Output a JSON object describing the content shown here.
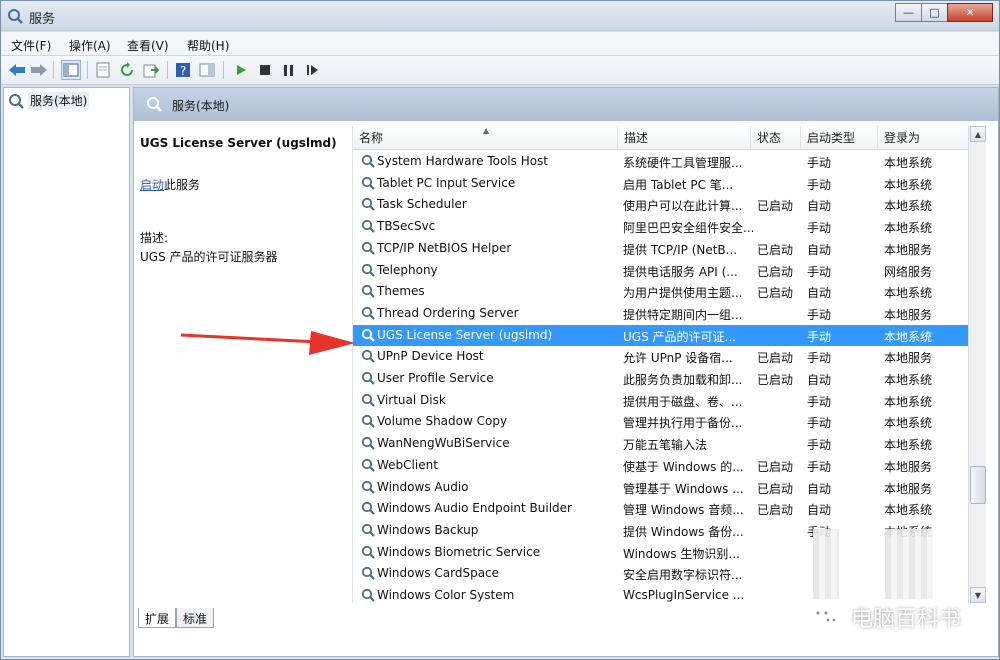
{
  "window": {
    "title": "服务"
  },
  "menu": [
    "文件(F)",
    "操作(A)",
    "查看(V)",
    "帮助(H)"
  ],
  "toolbar": {
    "icons": [
      "back-arrow-icon",
      "forward-arrow-icon",
      "console-tree-icon",
      "properties-icon",
      "refresh-icon",
      "export-icon",
      "help-icon",
      "show-hide-pane-icon",
      "start-icon",
      "stop-icon",
      "pause-icon",
      "restart-icon"
    ]
  },
  "tree": {
    "root_label": "服务(本地)"
  },
  "header": {
    "title": "服务(本地)"
  },
  "details": {
    "service_title": "UGS License Server (ugslmd)",
    "start_link": "启动",
    "start_suffix": "此服务",
    "desc_label": "描述:",
    "desc_text": "UGS 产品的许可证服务器"
  },
  "columns": {
    "name": "名称",
    "description": "描述",
    "status": "状态",
    "startup": "启动类型",
    "logon": "登录为"
  },
  "services": [
    {
      "name": "System Hardware Tools Host",
      "description": "系统硬件工具管理服...",
      "status": "",
      "startup": "手动",
      "logon": "本地系统"
    },
    {
      "name": "Tablet PC Input Service",
      "description": "启用 Tablet PC 笔...",
      "status": "",
      "startup": "手动",
      "logon": "本地系统"
    },
    {
      "name": "Task Scheduler",
      "description": "使用户可以在此计算...",
      "status": "已启动",
      "startup": "自动",
      "logon": "本地系统"
    },
    {
      "name": "TBSecSvc",
      "description": "阿里巴巴安全组件安全...",
      "status": "",
      "startup": "手动",
      "logon": "本地系统"
    },
    {
      "name": "TCP/IP NetBIOS Helper",
      "description": "提供 TCP/IP (NetB...",
      "status": "已启动",
      "startup": "自动",
      "logon": "本地服务"
    },
    {
      "name": "Telephony",
      "description": "提供电话服务 API (...",
      "status": "已启动",
      "startup": "手动",
      "logon": "网络服务"
    },
    {
      "name": "Themes",
      "description": "为用户提供使用主题...",
      "status": "已启动",
      "startup": "自动",
      "logon": "本地系统"
    },
    {
      "name": "Thread Ordering Server",
      "description": "提供特定期间内一组...",
      "status": "",
      "startup": "手动",
      "logon": "本地服务"
    },
    {
      "name": "UGS License Server (ugslmd)",
      "description": "UGS 产品的许可证...",
      "status": "",
      "startup": "手动",
      "logon": "本地系统"
    },
    {
      "name": "UPnP Device Host",
      "description": "允许 UPnP 设备宿...",
      "status": "已启动",
      "startup": "手动",
      "logon": "本地服务"
    },
    {
      "name": "User Profile Service",
      "description": "此服务负责加载和卸...",
      "status": "已启动",
      "startup": "自动",
      "logon": "本地系统"
    },
    {
      "name": "Virtual Disk",
      "description": "提供用于磁盘、卷、...",
      "status": "",
      "startup": "手动",
      "logon": "本地系统"
    },
    {
      "name": "Volume Shadow Copy",
      "description": "管理并执行用于备份...",
      "status": "",
      "startup": "手动",
      "logon": "本地系统"
    },
    {
      "name": "WanNengWuBiService",
      "description": "万能五笔输入法",
      "status": "",
      "startup": "手动",
      "logon": "本地系统"
    },
    {
      "name": "WebClient",
      "description": "使基于 Windows 的...",
      "status": "已启动",
      "startup": "手动",
      "logon": "本地服务"
    },
    {
      "name": "Windows Audio",
      "description": "管理基于 Windows ...",
      "status": "已启动",
      "startup": "自动",
      "logon": "本地服务"
    },
    {
      "name": "Windows Audio Endpoint Builder",
      "description": "管理 Windows 音频...",
      "status": "已启动",
      "startup": "自动",
      "logon": "本地系统"
    },
    {
      "name": "Windows Backup",
      "description": "提供 Windows 备份...",
      "status": "",
      "startup": "手动",
      "logon": "本地系统"
    },
    {
      "name": "Windows Biometric Service",
      "description": "Windows 生物识别...",
      "status": "",
      "startup": "",
      "logon": ""
    },
    {
      "name": "Windows CardSpace",
      "description": "安全启用数字标识符...",
      "status": "",
      "startup": "",
      "logon": ""
    },
    {
      "name": "Windows Color System",
      "description": "WcsPlugInService ...",
      "status": "",
      "startup": "",
      "logon": ""
    }
  ],
  "selected_index": 8,
  "tabs": [
    "扩展",
    "标准"
  ],
  "watermark": "电脑百科书",
  "colors": {
    "selection": "#3399ff",
    "arrow": "#e8332a",
    "link": "#2a5db0"
  }
}
